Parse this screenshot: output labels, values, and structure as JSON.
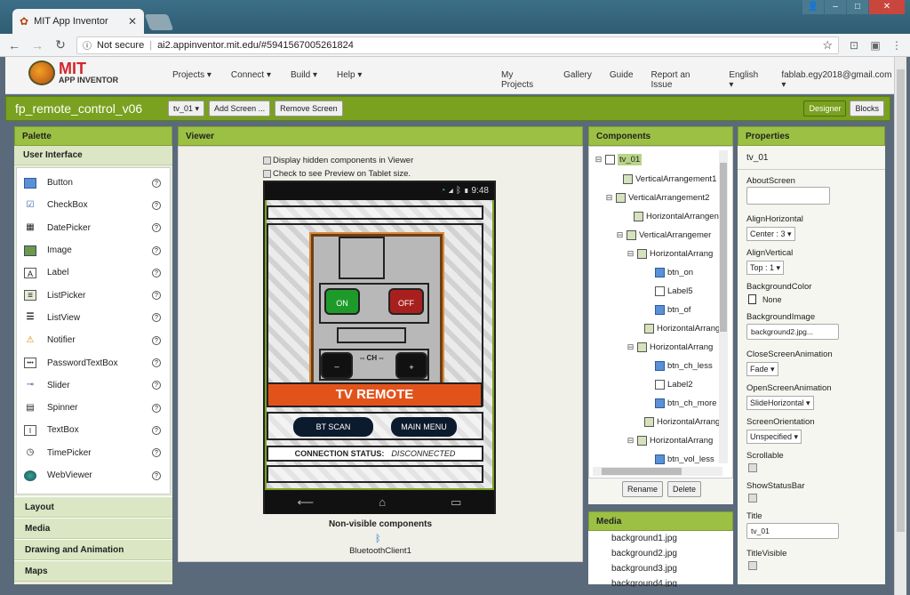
{
  "browser": {
    "tab_title": "MIT App Inventor",
    "security": "Not secure",
    "url": "ai2.appinventor.mit.edu/#5941567005261824"
  },
  "app": {
    "logo_line1": "MIT",
    "logo_line2": "APP INVENTOR",
    "nav_left": [
      "Projects ▾",
      "Connect ▾",
      "Build ▾",
      "Help ▾"
    ],
    "nav_right": [
      "My Projects",
      "Gallery",
      "Guide",
      "Report an Issue",
      "English ▾",
      "fablab.egy2018@gmail.com ▾"
    ]
  },
  "project": {
    "name": "fp_remote_control_v06",
    "screen_select": "tv_01 ▾",
    "add_screen": "Add Screen ...",
    "remove_screen": "Remove Screen",
    "designer": "Designer",
    "blocks": "Blocks"
  },
  "palette": {
    "title": "Palette",
    "section": "User Interface",
    "items": [
      "Button",
      "CheckBox",
      "DatePicker",
      "Image",
      "Label",
      "ListPicker",
      "ListView",
      "Notifier",
      "PasswordTextBox",
      "Slider",
      "Spinner",
      "TextBox",
      "TimePicker",
      "WebViewer"
    ],
    "help_glyph": "?",
    "categories": [
      "Layout",
      "Media",
      "Drawing and Animation",
      "Maps"
    ]
  },
  "viewer": {
    "title": "Viewer",
    "chk_hidden": "Display hidden components in Viewer",
    "chk_tablet": "Check to see Preview on Tablet size.",
    "status_time": "9:48",
    "on": "ON",
    "off": "OFF",
    "ch": "-- CH --",
    "minus": "_",
    "plus": "+",
    "tv_remote": "TV REMOTE",
    "bt_scan": "BT SCAN",
    "main_menu": "MAIN MENU",
    "conn_label": "CONNECTION STATUS:",
    "conn_value": "DISCONNECTED",
    "nav_back": "⟵",
    "nav_home": "⌂",
    "nav_recent": "▭",
    "nonvisible_title": "Non-visible components",
    "nonvisible_item": "BluetoothClient1"
  },
  "components": {
    "title": "Components",
    "tree": [
      {
        "label": "tv_01",
        "toggle": "⊟"
      },
      {
        "label": "VerticalArrangement1",
        "toggle": ""
      },
      {
        "label": "VerticalArrangement2",
        "toggle": "⊟"
      },
      {
        "label": "HorizontalArrangen",
        "toggle": ""
      },
      {
        "label": "VerticalArrangemer",
        "toggle": "⊟"
      },
      {
        "label": "HorizontalArrang",
        "toggle": "⊟"
      },
      {
        "label": "btn_on",
        "toggle": ""
      },
      {
        "label": "Label5",
        "toggle": ""
      },
      {
        "label": "btn_of",
        "toggle": ""
      },
      {
        "label": "HorizontalArrang",
        "toggle": ""
      },
      {
        "label": "HorizontalArrang",
        "toggle": "⊟"
      },
      {
        "label": "btn_ch_less",
        "toggle": ""
      },
      {
        "label": "Label2",
        "toggle": ""
      },
      {
        "label": "btn_ch_more",
        "toggle": ""
      },
      {
        "label": "HorizontalArrang",
        "toggle": ""
      },
      {
        "label": "HorizontalArrang",
        "toggle": "⊟"
      },
      {
        "label": "btn_vol_less",
        "toggle": ""
      }
    ],
    "rename": "Rename",
    "delete": "Delete"
  },
  "media": {
    "title": "Media",
    "files": [
      "background1.jpg",
      "background2.jpg",
      "background3.jpg",
      "background4.jpg"
    ]
  },
  "properties": {
    "title": "Properties",
    "component": "tv_01",
    "about_label": "AboutScreen",
    "align_h_label": "AlignHorizontal",
    "align_h_value": "Center : 3 ▾",
    "align_v_label": "AlignVertical",
    "align_v_value": "Top : 1 ▾",
    "bgcolor_label": "BackgroundColor",
    "bgcolor_value": "None",
    "bgimage_label": "BackgroundImage",
    "bgimage_value": "background2.jpg...",
    "close_anim_label": "CloseScreenAnimation",
    "close_anim_value": "Fade ▾",
    "open_anim_label": "OpenScreenAnimation",
    "open_anim_value": "SlideHorizontal ▾",
    "orientation_label": "ScreenOrientation",
    "orientation_value": "Unspecified ▾",
    "scrollable_label": "Scrollable",
    "statusbar_label": "ShowStatusBar",
    "title_label": "Title",
    "title_value": "tv_01",
    "titlevisible_label": "TitleVisible"
  }
}
